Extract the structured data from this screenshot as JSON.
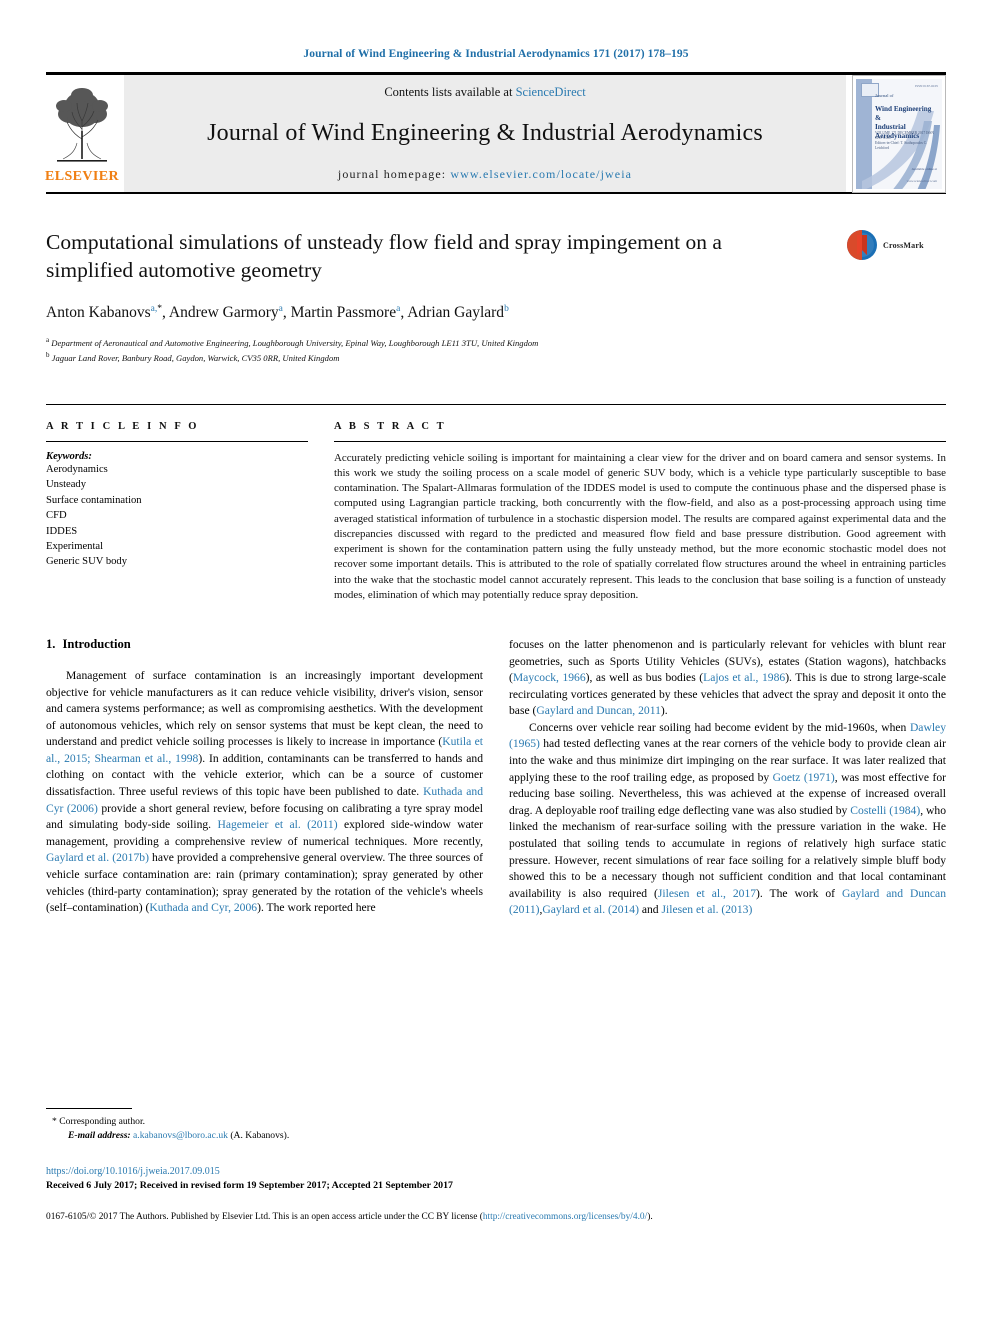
{
  "running_head": "Journal of Wind Engineering & Industrial Aerodynamics 171 (2017) 178–195",
  "masthead": {
    "contents_prefix": "Contents lists available at ",
    "sciencedirect": "ScienceDirect",
    "journal_title": "Journal of Wind Engineering & Industrial Aerodynamics",
    "homepage_label": "journal homepage: ",
    "homepage_url": "www.elsevier.com/locate/jweia",
    "publisher_wordmark": "ELSEVIER",
    "cover": {
      "kicker": "Journal of",
      "title_line1": "Wind Engineering &",
      "title_line2": "Industrial Aerodynamics",
      "meta_line1": "VOLUME 171   DECEMBER 2017   ISSN 0167-6105",
      "meta_line2": "Editors-in-Chief: T. Stathopoulos  C. Letchford",
      "isbn": "ISSN 0167-6105",
      "foot1": "Available online at",
      "foot2": "www.sciencedirect.com"
    }
  },
  "crossmark": {
    "label": "CrossMark"
  },
  "article": {
    "title": "Computational simulations of unsteady flow field and spray impingement on a simplified automotive geometry",
    "authors": [
      {
        "name": "Anton Kabanovs",
        "marks": "a,",
        "star": "*"
      },
      {
        "name": "Andrew Garmory",
        "marks": "a"
      },
      {
        "name": "Martin Passmore",
        "marks": "a"
      },
      {
        "name": "Adrian Gaylard",
        "marks": "b"
      }
    ],
    "affiliations": [
      {
        "mark": "a",
        "text": "Department of Aeronautical and Automotive Engineering, Loughborough University, Epinal Way, Loughborough LE11 3TU, United Kingdom"
      },
      {
        "mark": "b",
        "text": "Jaguar Land Rover, Banbury Road, Gaydon, Warwick, CV35 0RR, United Kingdom"
      }
    ]
  },
  "info": {
    "heading": "A R T I C L E  I N F O",
    "keywords_label": "Keywords:",
    "keywords": [
      "Aerodynamics",
      "Unsteady",
      "Surface contamination",
      "CFD",
      "IDDES",
      "Experimental",
      "Generic SUV body"
    ]
  },
  "abstract": {
    "heading": "A B S T R A C T",
    "text": "Accurately predicting vehicle soiling is important for maintaining a clear view for the driver and on board camera and sensor systems. In this work we study the soiling process on a scale model of generic SUV body, which is a vehicle type particularly susceptible to base contamination. The Spalart-Allmaras formulation of the IDDES model is used to compute the continuous phase and the dispersed phase is computed using Lagrangian particle tracking, both concurrently with the flow-field, and also as a post-processing approach using time averaged statistical information of turbulence in a stochastic dispersion model. The results are compared against experimental data and the discrepancies discussed with regard to the predicted and measured flow field and base pressure distribution. Good agreement with experiment is shown for the contamination pattern using the fully unsteady method, but the more economic stochastic model does not recover some important details. This is attributed to the role of spatially correlated flow structures around the wheel in entraining particles into the wake that the stochastic model cannot accurately represent. This leads to the conclusion that base soiling is a function of unsteady modes, elimination of which may potentially reduce spray deposition."
  },
  "section": {
    "number": "1.",
    "title": "Introduction"
  },
  "body": {
    "left_p1_a": "Management of surface contamination is an increasingly important development objective for vehicle manufacturers as it can reduce vehicle visibility, driver's vision, sensor and camera systems performance; as well as compromising aesthetics. With the development of autonomous vehicles, which rely on sensor systems that must be kept clean, the need to understand and predict vehicle soiling processes is likely to increase in importance (",
    "cite_kutila": "Kutila et al., 2015; Shearman et al., 1998",
    "left_p1_b": "). In addition, contaminants can be transferred to hands and clothing on contact with the vehicle exterior, which can be a source of customer dissatisfaction. Three useful reviews of this topic have been published to date. ",
    "cite_kuthada_cyr_2006": "Kuthada and Cyr (2006)",
    "left_p1_c": " provide a short general review, before focusing on calibrating a tyre spray model and simulating body-side soiling. ",
    "cite_hagemeier": "Hagemeier et al. (2011)",
    "left_p1_d": " explored side-window water management, providing a comprehensive review of numerical techniques. More recently, ",
    "cite_gaylard_2017b": "Gaylard et al. (2017b)",
    "left_p1_e": " have provided a comprehensive general overview. The three sources of vehicle surface contamination are: rain (primary contamination); spray generated by other vehicles (third-party contamination); spray generated by the rotation of the vehicle's wheels (self–contamination) (",
    "cite_kuthada_cyr_short": "Kuthada and Cyr, 2006",
    "left_p1_f": "). The work reported here",
    "right_p1_a": "focuses on the latter phenomenon and is particularly relevant for vehicles with blunt rear geometries, such as Sports Utility Vehicles (SUVs), estates (Station wagons), hatchbacks (",
    "cite_maycock": "Maycock, 1966",
    "right_p1_b": "), as well as bus bodies (",
    "cite_lajos": "Lajos et al., 1986",
    "right_p1_c": "). This is due to strong large-scale recirculating vortices generated by these vehicles that advect the spray and deposit it onto the base (",
    "cite_gaylard_duncan_2011": "Gaylard and Duncan, 2011",
    "right_p1_d": ").",
    "right_p2_a": "Concerns over vehicle rear soiling had become evident by the mid-1960s, when ",
    "cite_dawley": "Dawley (1965)",
    "right_p2_b": " had tested deflecting vanes at the rear corners of the vehicle body to provide clean air into the wake and thus minimize dirt impinging on the rear surface. It was later realized that applying these to the roof trailing edge, as proposed by ",
    "cite_goetz": "Goetz (1971)",
    "right_p2_c": ", was most effective for reducing base soiling. Nevertheless, this was achieved at the expense of increased overall drag. A deployable roof trailing edge deflecting vane was also studied by ",
    "cite_costelli": "Costelli (1984)",
    "right_p2_d": ", who linked the mechanism of rear-surface soiling with the pressure variation in the wake. He postulated that soiling tends to accumulate in regions of relatively high surface static pressure. However, recent simulations of rear face soiling for a relatively simple bluff body showed this to be a necessary though not sufficient condition and that local contaminant availability is also required (",
    "cite_jilesen_2017": "Jilesen et al., 2017",
    "right_p2_e": "). The work of ",
    "cite_gaylard_duncan_2011b": "Gaylard and Duncan (2011)",
    "right_p2_f": ",",
    "cite_gaylard_2014": "Gaylard et al. (2014)",
    "right_p2_g": " and ",
    "cite_jilesen_2013": "Jilesen et al. (2013)"
  },
  "footnotes": {
    "corresponding_mark": "*",
    "corresponding_text": "Corresponding author.",
    "email_label": "E-mail address:",
    "email": "a.kabanovs@lboro.ac.uk",
    "email_suffix": "(A. Kabanovs)."
  },
  "publication": {
    "doi": "https://doi.org/10.1016/j.jweia.2017.09.015",
    "received": "Received 6 July 2017; Received in revised form 19 September 2017; Accepted 21 September 2017",
    "copyright_a": "0167-6105/© 2017 The Authors. Published by Elsevier Ltd. This is an open access article under the CC BY license (",
    "license_url": "http://creativecommons.org/licenses/by/4.0/",
    "copyright_b": ")."
  },
  "colors": {
    "link": "#2a7ab0",
    "elsevier_orange": "#f07f13",
    "masthead_grey": "#ececec"
  }
}
